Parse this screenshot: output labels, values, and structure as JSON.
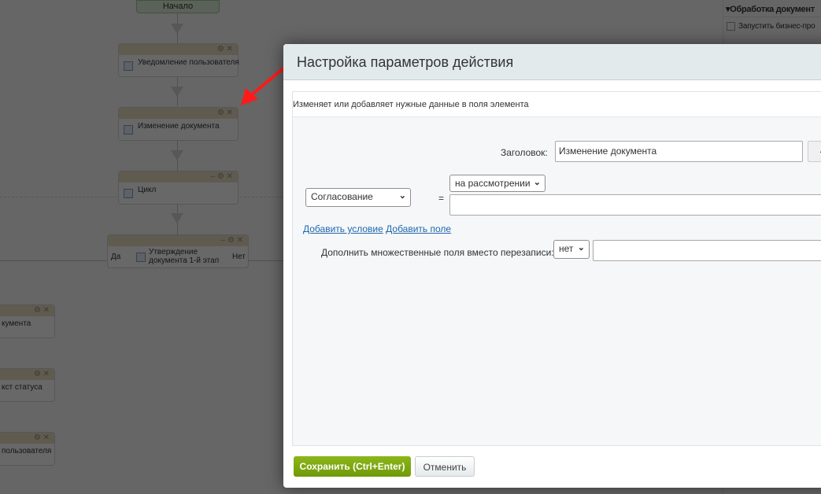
{
  "diagram": {
    "start": "Начало",
    "nodes": [
      {
        "label": "Уведомление пользователя"
      },
      {
        "label": "Изменение документа"
      },
      {
        "label": "Цикл"
      },
      {
        "label": "Утверждение документа 1-й этап",
        "yes": "Да",
        "no": "Нет"
      }
    ],
    "left_nodes": [
      "кумента",
      "кст статуса",
      "пользователя"
    ]
  },
  "sidebar": {
    "section": "Обработка документ",
    "item": "Запустить бизнес-про"
  },
  "dialog": {
    "title": "Настройка параметров действия",
    "description": "Изменяет или добавляет нужные данные в поля элемента",
    "title_label": "Заголовок:",
    "title_value": "Изменение документа",
    "dots_button": "...",
    "field_select": "Согласование",
    "equals": "=",
    "value_select": "на рассмотрении",
    "value_input": "",
    "add_condition": "Добавить условие",
    "add_field": "Добавить поле",
    "append_label": "Дополнить множественные поля вместо перезаписи:",
    "append_select": "нет",
    "append_input": "",
    "save_button": "Сохранить (Ctrl+Enter)",
    "cancel_button": "Отменить"
  },
  "colors": {
    "save": "#7ba10e",
    "annotation_arrow": "#ff1a1a"
  }
}
